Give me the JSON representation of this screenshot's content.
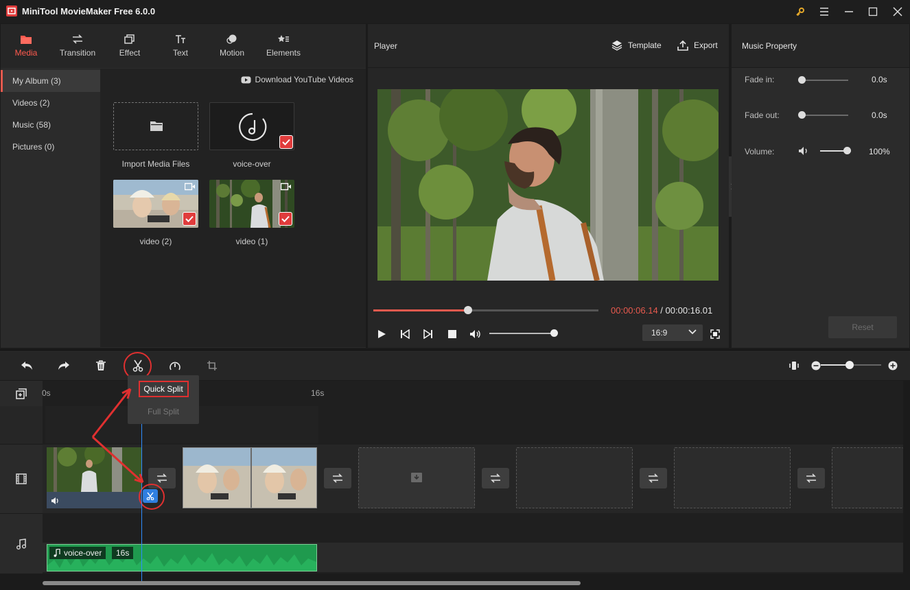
{
  "app": {
    "title": "MiniTool MovieMaker Free 6.0.0"
  },
  "window_controls": [
    "key-icon",
    "menu-icon",
    "minimize-icon",
    "maximize-icon",
    "close-icon"
  ],
  "tabs": [
    {
      "label": "Media",
      "icon": "folder-icon",
      "active": true
    },
    {
      "label": "Transition",
      "icon": "transition-icon",
      "active": false
    },
    {
      "label": "Effect",
      "icon": "effect-icon",
      "active": false
    },
    {
      "label": "Text",
      "icon": "text-icon",
      "active": false
    },
    {
      "label": "Motion",
      "icon": "motion-icon",
      "active": false
    },
    {
      "label": "Elements",
      "icon": "elements-icon",
      "active": false
    }
  ],
  "library": {
    "items": [
      {
        "label": "My Album (3)",
        "active": true
      },
      {
        "label": "Videos (2)",
        "active": false
      },
      {
        "label": "Music (58)",
        "active": false
      },
      {
        "label": "Pictures (0)",
        "active": false
      }
    ],
    "download_link": "Download YouTube Videos"
  },
  "media_tiles": [
    {
      "label": "Import Media Files"
    },
    {
      "label": "voice-over"
    },
    {
      "label": "video (2)"
    },
    {
      "label": "video (1)"
    }
  ],
  "player": {
    "label": "Player",
    "template_label": "Template",
    "export_label": "Export",
    "current_time": "00:00:06.14",
    "separator": " / ",
    "total_time": "00:00:16.01",
    "progress": 0.42,
    "volume": 1.0,
    "aspect_ratio": "16:9"
  },
  "properties": {
    "title": "Music Property",
    "fade_in_label": "Fade in:",
    "fade_in_value": "0.0s",
    "fade_out_label": "Fade out:",
    "fade_out_value": "0.0s",
    "volume_label": "Volume:",
    "volume_value": "100%",
    "reset_label": "Reset"
  },
  "toolbar": {
    "tools": [
      "undo-icon",
      "redo-icon",
      "delete-icon",
      "split-icon",
      "speed-icon",
      "crop-icon"
    ]
  },
  "split_menu": {
    "quick_split": "Quick Split",
    "full_split": "Full Split"
  },
  "timeline": {
    "ruler_start": "0s",
    "ruler_mark": "16s",
    "audio_clip_label": "voice-over",
    "audio_clip_duration": "16s"
  },
  "colors": {
    "accent": "#e85a4e",
    "highlight_red": "#e03030",
    "playhead": "#2f8cff",
    "audio_clip": "#1f9a4e"
  }
}
